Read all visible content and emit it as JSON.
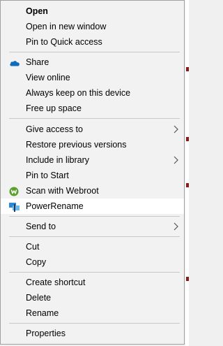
{
  "menu": {
    "items": [
      {
        "label": "Open"
      },
      {
        "label": "Open in new window"
      },
      {
        "label": "Pin to Quick access"
      },
      {
        "label": "Share"
      },
      {
        "label": "View online"
      },
      {
        "label": "Always keep on this device"
      },
      {
        "label": "Free up space"
      },
      {
        "label": "Give access to"
      },
      {
        "label": "Restore previous versions"
      },
      {
        "label": "Include in library"
      },
      {
        "label": "Pin to Start"
      },
      {
        "label": "Scan with Webroot"
      },
      {
        "label": "PowerRename"
      },
      {
        "label": "Send to"
      },
      {
        "label": "Cut"
      },
      {
        "label": "Copy"
      },
      {
        "label": "Create shortcut"
      },
      {
        "label": "Delete"
      },
      {
        "label": "Rename"
      },
      {
        "label": "Properties"
      }
    ],
    "icons": {
      "share": "onedrive-cloud-icon",
      "scan": "webroot-icon",
      "powerrename": "powerrename-icon",
      "submenu": "chevron-right-icon"
    },
    "colors": {
      "background": "#f2f2f2",
      "hover": "#ffffff",
      "separator": "#c8c8c8",
      "onedrive": "#0f6cbd",
      "webroot": "#5aa02c"
    }
  }
}
